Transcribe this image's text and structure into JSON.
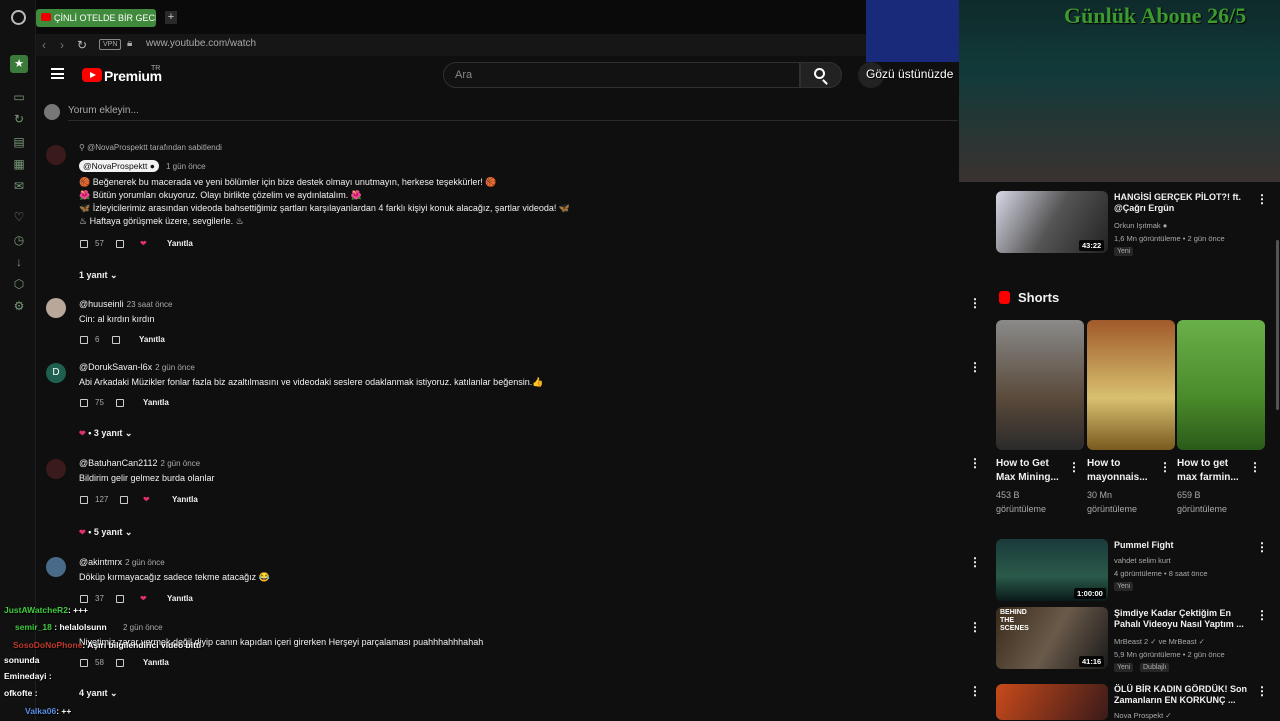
{
  "browser": {
    "tab_title": "ÇİNLİ OTELDE BİR GECE!",
    "vpn": "VPN",
    "url": "www.youtube.com/watch"
  },
  "header": {
    "brand": "Premium",
    "region": "TR",
    "search_placeholder": "Ara"
  },
  "overlays": {
    "banner": "Gözü üstünüzde",
    "subs": "Günlük Abone 26/5"
  },
  "composer": {
    "placeholder": "Yorum ekleyin..."
  },
  "comments": [
    {
      "pinned": "@NovaProspektt tarafından sabitlendi",
      "author": "@NovaProspektt",
      "time": "1 gün önce",
      "lines": [
        "🏀 Beğenerek bu macerada ve yeni bölümler için bize destek olmayı unutmayın, herkese teşekkürler! 🏀",
        "🌺 Bütün yorumları okuyoruz. Olayı birlikte çözelim ve aydınlatalım. 🌺",
        "🦋 İzleyicilerimiz arasından videoda bahsettiğimiz şartları karşılayanlardan 4 farklı kişiyi konuk alacağız, şartlar videoda! 🦋",
        "♨ Haftaya görüşmek üzere, sevgilerle. ♨"
      ],
      "likes": "57",
      "reply": "Yanıtla",
      "replies": "1 yanıt"
    },
    {
      "author": "@huuseinli",
      "time": "23 saat önce",
      "text": "Cin: al kırdın kırdın",
      "likes": "6",
      "reply": "Yanıtla"
    },
    {
      "author": "@DorukSavan-l6x",
      "time": "2 gün önce",
      "text": "Abi Arkadaki Müzikler fonlar fazla biz azaltılmasını ve videodaki seslere odaklanmak istiyoruz. katılanlar beğensin.👍",
      "likes": "75",
      "reply": "Yanıtla",
      "replies": "3 yanıt"
    },
    {
      "author": "@BatuhanCan2112",
      "time": "2 gün önce",
      "text": "Bildirim gelir gelmez burda olanlar",
      "likes": "127",
      "reply": "Yanıtla",
      "replies": "5 yanıt"
    },
    {
      "author": "@akintmrx",
      "time": "2 gün önce",
      "text": "Döküp kırmayacağız sadece tekme atacağız 😂",
      "likes": "37",
      "reply": "Yanıtla"
    },
    {
      "author": "",
      "time": "2 gün önce",
      "text": "Niyetimiz zarar vermek değil diyip canın kapıdan içeri girerken Herşeyi parçalaması puahhhahhhahah",
      "likes": "58",
      "reply": "Yanıtla",
      "replies": "4 yanıt"
    }
  ],
  "avatar_letters": {
    "doruk": "D"
  },
  "chat": [
    {
      "user": "JustAWatcheR2",
      "msg": ": +++",
      "color": "#3ecb3e"
    },
    {
      "user": "semir_18",
      "msg": "helalolsunn",
      "color": "#3ecb3e"
    },
    {
      "user": "SosoDoNoPhone",
      "msg": ": Aşırı bilgilendirici video bitti",
      "color": "#c0392b"
    },
    {
      "user": "sonunda",
      "msg": "",
      "color": "#ffffff"
    },
    {
      "user": "Eminedayi",
      "msg": ":",
      "color": "#ffffff"
    },
    {
      "user": "ofkofte",
      "msg": ":",
      "color": "#ffffff"
    },
    {
      "user": "Valka06",
      "msg": ": ++",
      "color": "#5b8ee6"
    }
  ],
  "sidebar": {
    "videos_top": [
      {
        "title": "HANGİSİ GERÇEK PİLOT?! ft. @Çağrı Ergün",
        "channel": "Orkun Işıtmak",
        "meta": "1,6 Mn görüntüleme • 2 gün önce",
        "badge": "Yeni",
        "duration": "43:22"
      }
    ],
    "shorts_label": "Shorts",
    "shorts": [
      {
        "title": "How to Get Max Mining...",
        "views": "453 B görüntüleme"
      },
      {
        "title": "How to mayonnais...",
        "views": "30 Mn görüntüleme"
      },
      {
        "title": "How to get max farmin...",
        "views": "659 B görüntüleme"
      }
    ],
    "videos_bottom": [
      {
        "title": "Pummel Fight",
        "channel": "vahdet selim kurt",
        "meta": "4 görüntüleme • 8 saat önce",
        "badge": "Yeni",
        "duration": "1:00:00"
      },
      {
        "title": "Şimdiye Kadar Çektiğim En Pahalı Videoyu Nasıl Yaptım ...",
        "channel": "MrBeast 2 ✓ ve MrBeast ✓",
        "meta": "5,9 Mn görüntüleme • 2 gün önce",
        "badge": "Yeni",
        "badge2": "Dublajlı",
        "duration": "41:16",
        "thumb_text": "BEHIND THE SCENES"
      },
      {
        "title": "ÖLÜ BİR KADIN GÖRDÜK! Son Zamanların EN KORKUNÇ ...",
        "channel": "Nova Prospekt ✓",
        "meta": "",
        "badge": ""
      }
    ]
  }
}
